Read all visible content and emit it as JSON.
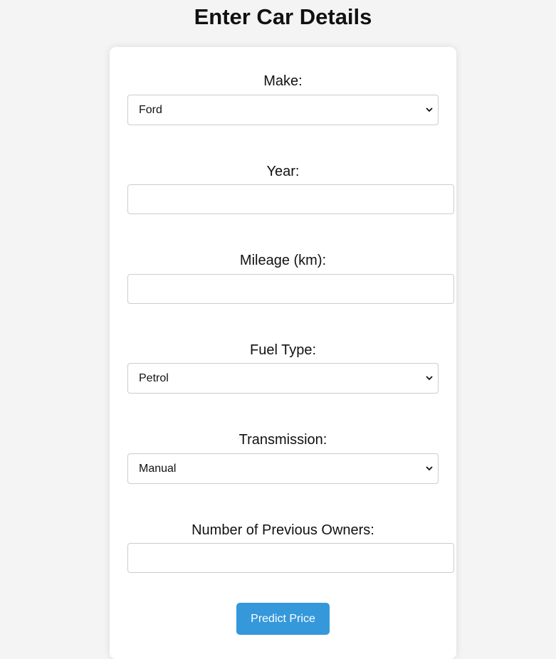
{
  "page": {
    "title": "Enter Car Details"
  },
  "form": {
    "make": {
      "label": "Make:",
      "selected": "Ford"
    },
    "year": {
      "label": "Year:",
      "value": "",
      "placeholder": ""
    },
    "mileage": {
      "label": "Mileage (km):",
      "value": "",
      "placeholder": ""
    },
    "fuel_type": {
      "label": "Fuel Type:",
      "selected": "Petrol"
    },
    "transmission": {
      "label": "Transmission:",
      "selected": "Manual"
    },
    "previous_owners": {
      "label": "Number of Previous Owners:",
      "value": "",
      "placeholder": ""
    },
    "submit_label": "Predict Price"
  },
  "icons": {
    "dropdown": "chevron-down-icon"
  },
  "colors": {
    "background": "#f4f4f4",
    "card": "#ffffff",
    "button": "#3498db",
    "button_text": "#ffffff",
    "border": "#cccccc"
  }
}
